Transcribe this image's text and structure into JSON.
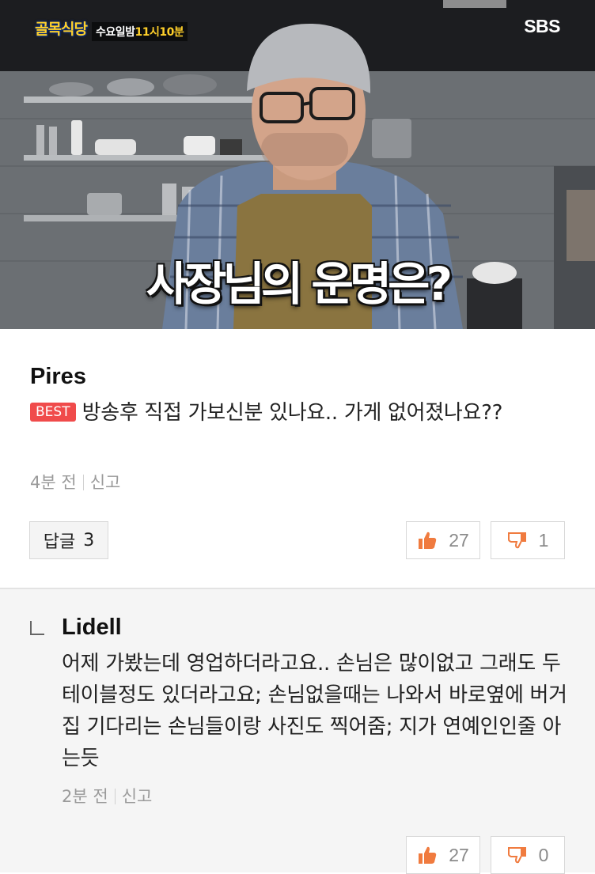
{
  "video": {
    "show_logo": "골목식당",
    "schedule_prefix": "수요일밤",
    "schedule_time": "11시10분",
    "network": "SBS",
    "caption": "사장님의 운명은?"
  },
  "comment": {
    "author": "Pires",
    "badge": "BEST",
    "text": "방송후 직접 가보신분 있나요.. 가게 없어졌나요??",
    "time": "4분 전",
    "report": "신고",
    "reply_label": "답글",
    "reply_count": "3",
    "likes": "27",
    "dislikes": "1"
  },
  "reply": {
    "author": "Lidell",
    "text": "어제 가봤는데 영업하더라고요.. 손님은 많이없고 그래도 두테이블정도 있더라고요; 손님없을때는 나와서 바로옆에 버거집 기다리는 손님들이랑 사진도 찍어줌; 지가 연예인인줄 아는듯",
    "time": "2분 전",
    "report": "신고",
    "likes": "27",
    "dislikes": "0"
  },
  "colors": {
    "best_badge": "#f04b4b",
    "thumb_up": "#f07b3f",
    "thumb_down": "#f07b3f",
    "logo_yellow": "#ffd02a"
  }
}
